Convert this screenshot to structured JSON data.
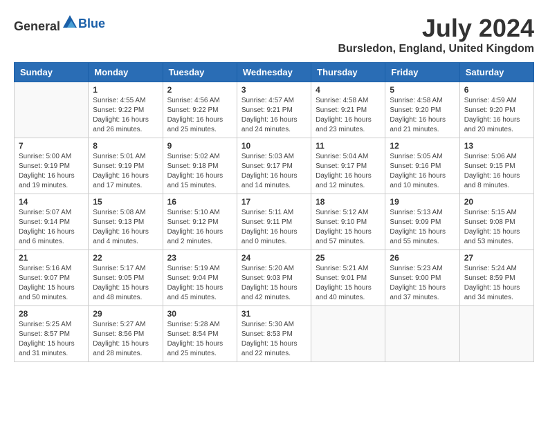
{
  "header": {
    "logo_general": "General",
    "logo_blue": "Blue",
    "month_year": "July 2024",
    "location": "Bursledon, England, United Kingdom"
  },
  "days_of_week": [
    "Sunday",
    "Monday",
    "Tuesday",
    "Wednesday",
    "Thursday",
    "Friday",
    "Saturday"
  ],
  "weeks": [
    [
      {
        "day": "",
        "sunrise": "",
        "sunset": "",
        "daylight": ""
      },
      {
        "day": "1",
        "sunrise": "Sunrise: 4:55 AM",
        "sunset": "Sunset: 9:22 PM",
        "daylight": "Daylight: 16 hours and 26 minutes."
      },
      {
        "day": "2",
        "sunrise": "Sunrise: 4:56 AM",
        "sunset": "Sunset: 9:22 PM",
        "daylight": "Daylight: 16 hours and 25 minutes."
      },
      {
        "day": "3",
        "sunrise": "Sunrise: 4:57 AM",
        "sunset": "Sunset: 9:21 PM",
        "daylight": "Daylight: 16 hours and 24 minutes."
      },
      {
        "day": "4",
        "sunrise": "Sunrise: 4:58 AM",
        "sunset": "Sunset: 9:21 PM",
        "daylight": "Daylight: 16 hours and 23 minutes."
      },
      {
        "day": "5",
        "sunrise": "Sunrise: 4:58 AM",
        "sunset": "Sunset: 9:20 PM",
        "daylight": "Daylight: 16 hours and 21 minutes."
      },
      {
        "day": "6",
        "sunrise": "Sunrise: 4:59 AM",
        "sunset": "Sunset: 9:20 PM",
        "daylight": "Daylight: 16 hours and 20 minutes."
      }
    ],
    [
      {
        "day": "7",
        "sunrise": "Sunrise: 5:00 AM",
        "sunset": "Sunset: 9:19 PM",
        "daylight": "Daylight: 16 hours and 19 minutes."
      },
      {
        "day": "8",
        "sunrise": "Sunrise: 5:01 AM",
        "sunset": "Sunset: 9:19 PM",
        "daylight": "Daylight: 16 hours and 17 minutes."
      },
      {
        "day": "9",
        "sunrise": "Sunrise: 5:02 AM",
        "sunset": "Sunset: 9:18 PM",
        "daylight": "Daylight: 16 hours and 15 minutes."
      },
      {
        "day": "10",
        "sunrise": "Sunrise: 5:03 AM",
        "sunset": "Sunset: 9:17 PM",
        "daylight": "Daylight: 16 hours and 14 minutes."
      },
      {
        "day": "11",
        "sunrise": "Sunrise: 5:04 AM",
        "sunset": "Sunset: 9:17 PM",
        "daylight": "Daylight: 16 hours and 12 minutes."
      },
      {
        "day": "12",
        "sunrise": "Sunrise: 5:05 AM",
        "sunset": "Sunset: 9:16 PM",
        "daylight": "Daylight: 16 hours and 10 minutes."
      },
      {
        "day": "13",
        "sunrise": "Sunrise: 5:06 AM",
        "sunset": "Sunset: 9:15 PM",
        "daylight": "Daylight: 16 hours and 8 minutes."
      }
    ],
    [
      {
        "day": "14",
        "sunrise": "Sunrise: 5:07 AM",
        "sunset": "Sunset: 9:14 PM",
        "daylight": "Daylight: 16 hours and 6 minutes."
      },
      {
        "day": "15",
        "sunrise": "Sunrise: 5:08 AM",
        "sunset": "Sunset: 9:13 PM",
        "daylight": "Daylight: 16 hours and 4 minutes."
      },
      {
        "day": "16",
        "sunrise": "Sunrise: 5:10 AM",
        "sunset": "Sunset: 9:12 PM",
        "daylight": "Daylight: 16 hours and 2 minutes."
      },
      {
        "day": "17",
        "sunrise": "Sunrise: 5:11 AM",
        "sunset": "Sunset: 9:11 PM",
        "daylight": "Daylight: 16 hours and 0 minutes."
      },
      {
        "day": "18",
        "sunrise": "Sunrise: 5:12 AM",
        "sunset": "Sunset: 9:10 PM",
        "daylight": "Daylight: 15 hours and 57 minutes."
      },
      {
        "day": "19",
        "sunrise": "Sunrise: 5:13 AM",
        "sunset": "Sunset: 9:09 PM",
        "daylight": "Daylight: 15 hours and 55 minutes."
      },
      {
        "day": "20",
        "sunrise": "Sunrise: 5:15 AM",
        "sunset": "Sunset: 9:08 PM",
        "daylight": "Daylight: 15 hours and 53 minutes."
      }
    ],
    [
      {
        "day": "21",
        "sunrise": "Sunrise: 5:16 AM",
        "sunset": "Sunset: 9:07 PM",
        "daylight": "Daylight: 15 hours and 50 minutes."
      },
      {
        "day": "22",
        "sunrise": "Sunrise: 5:17 AM",
        "sunset": "Sunset: 9:05 PM",
        "daylight": "Daylight: 15 hours and 48 minutes."
      },
      {
        "day": "23",
        "sunrise": "Sunrise: 5:19 AM",
        "sunset": "Sunset: 9:04 PM",
        "daylight": "Daylight: 15 hours and 45 minutes."
      },
      {
        "day": "24",
        "sunrise": "Sunrise: 5:20 AM",
        "sunset": "Sunset: 9:03 PM",
        "daylight": "Daylight: 15 hours and 42 minutes."
      },
      {
        "day": "25",
        "sunrise": "Sunrise: 5:21 AM",
        "sunset": "Sunset: 9:01 PM",
        "daylight": "Daylight: 15 hours and 40 minutes."
      },
      {
        "day": "26",
        "sunrise": "Sunrise: 5:23 AM",
        "sunset": "Sunset: 9:00 PM",
        "daylight": "Daylight: 15 hours and 37 minutes."
      },
      {
        "day": "27",
        "sunrise": "Sunrise: 5:24 AM",
        "sunset": "Sunset: 8:59 PM",
        "daylight": "Daylight: 15 hours and 34 minutes."
      }
    ],
    [
      {
        "day": "28",
        "sunrise": "Sunrise: 5:25 AM",
        "sunset": "Sunset: 8:57 PM",
        "daylight": "Daylight: 15 hours and 31 minutes."
      },
      {
        "day": "29",
        "sunrise": "Sunrise: 5:27 AM",
        "sunset": "Sunset: 8:56 PM",
        "daylight": "Daylight: 15 hours and 28 minutes."
      },
      {
        "day": "30",
        "sunrise": "Sunrise: 5:28 AM",
        "sunset": "Sunset: 8:54 PM",
        "daylight": "Daylight: 15 hours and 25 minutes."
      },
      {
        "day": "31",
        "sunrise": "Sunrise: 5:30 AM",
        "sunset": "Sunset: 8:53 PM",
        "daylight": "Daylight: 15 hours and 22 minutes."
      },
      {
        "day": "",
        "sunrise": "",
        "sunset": "",
        "daylight": ""
      },
      {
        "day": "",
        "sunrise": "",
        "sunset": "",
        "daylight": ""
      },
      {
        "day": "",
        "sunrise": "",
        "sunset": "",
        "daylight": ""
      }
    ]
  ]
}
